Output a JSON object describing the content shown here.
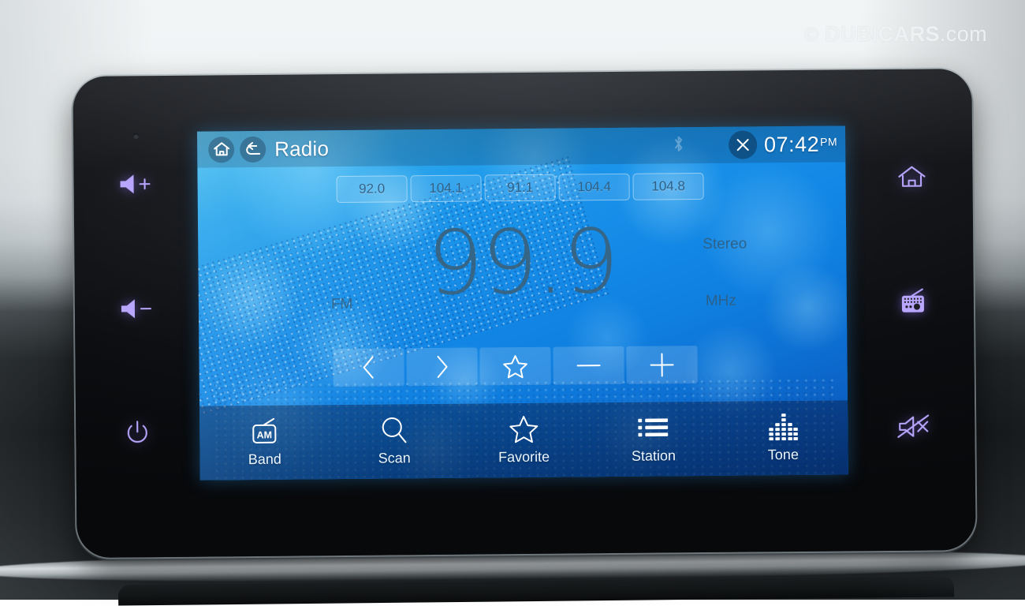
{
  "watermark": {
    "copyright": "©",
    "brand": "DUBICARS",
    "tld": ".com"
  },
  "statusbar": {
    "home_icon": "home-icon",
    "back_icon": "back-arrow-icon",
    "title": "Radio",
    "bluetooth_icon": "bluetooth-icon",
    "close_icon": "close-icon",
    "time": "07:42",
    "ampm": "PM"
  },
  "presets": [
    {
      "label": "92.0"
    },
    {
      "label": "104.1"
    },
    {
      "label": "91.1"
    },
    {
      "label": "104.4"
    },
    {
      "label": "104.8"
    }
  ],
  "tuner": {
    "frequency": "99.9",
    "band_label": "FM",
    "unit_label": "MHz",
    "stereo_label": "Stereo"
  },
  "transport": [
    {
      "name": "previous-station-button",
      "icon": "chevron-left-icon"
    },
    {
      "name": "next-station-button",
      "icon": "chevron-right-icon"
    },
    {
      "name": "favorite-toggle-button",
      "icon": "star-icon"
    },
    {
      "name": "tune-down-button",
      "icon": "minus-icon"
    },
    {
      "name": "tune-up-button",
      "icon": "plus-icon"
    }
  ],
  "navbar": [
    {
      "label": "Band",
      "icon": "am-radio-icon",
      "badge": "AM"
    },
    {
      "label": "Scan",
      "icon": "search-icon"
    },
    {
      "label": "Favorite",
      "icon": "star-icon"
    },
    {
      "label": "Station",
      "icon": "list-icon"
    },
    {
      "label": "Tone",
      "icon": "equalizer-icon"
    }
  ],
  "hardkeys": {
    "left": [
      {
        "label": "Volume Up",
        "icon": "volume-up-icon"
      },
      {
        "label": "Volume Down",
        "icon": "volume-down-icon"
      },
      {
        "label": "Power",
        "icon": "power-icon"
      }
    ],
    "right": [
      {
        "label": "Home",
        "icon": "home-icon"
      },
      {
        "label": "Radio",
        "icon": "radio-icon"
      },
      {
        "label": "Mute",
        "icon": "mute-icon"
      }
    ]
  },
  "colors": {
    "accent_key": "#b9a6ff",
    "screen_blue": "#1489e6",
    "freq_text": "#38627f",
    "nav_text": "#eaf6ff"
  }
}
